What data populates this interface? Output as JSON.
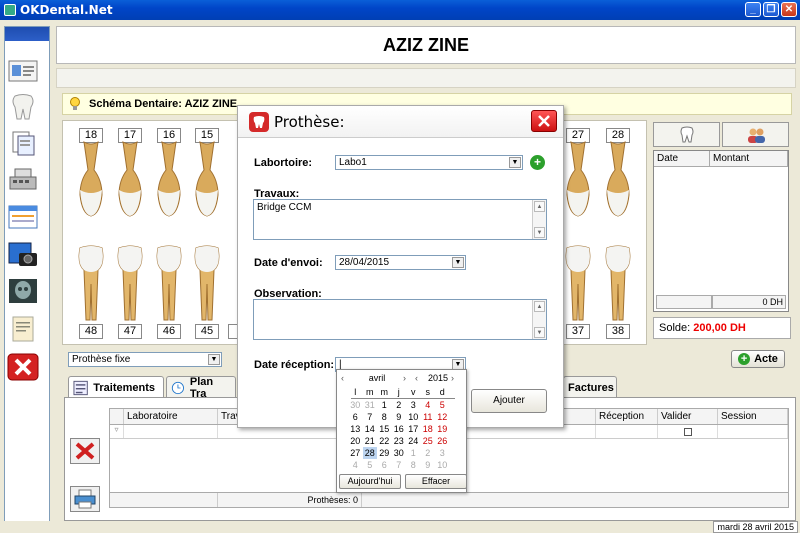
{
  "window": {
    "title": "OKDental.Net",
    "min": "_",
    "max": "❐",
    "close": "✕"
  },
  "patient": {
    "name": "AZIZ ZINE"
  },
  "schema": {
    "label": "Schéma Dentaire: AZIZ ZINE"
  },
  "teeth": {
    "upper": [
      "18",
      "17",
      "16",
      "15",
      "",
      "",
      "",
      "",
      "",
      "",
      "27",
      "28"
    ],
    "lower": [
      "48",
      "47",
      "46",
      "45",
      "4",
      "",
      "",
      "",
      "",
      "",
      "37",
      "38"
    ]
  },
  "right_panel": {
    "columns": [
      "Date",
      "Montant"
    ],
    "total": "0 DH",
    "solde_label": "Solde:",
    "solde_value": "200,00 DH"
  },
  "prothese_type": {
    "value": "Prothèse fixe"
  },
  "acte_button": "Acte",
  "tabs": [
    "Traitements",
    "Plan Tra",
    "Factures"
  ],
  "grid": {
    "columns": [
      "Laboratoire",
      "Trav",
      "",
      "Réception",
      "Valider",
      "Session"
    ],
    "footer": "Prothèses: 0"
  },
  "dialog": {
    "title": "Prothèse:",
    "labo_label": "Labortoire:",
    "labo_value": "Labo1",
    "travaux_label": "Travaux:",
    "travaux_value": "Bridge CCM",
    "date_envoi_label": "Date d'envoi:",
    "date_envoi_value": "28/04/2015",
    "observation_label": "Observation:",
    "date_reception_label": "Date réception:",
    "date_reception_value": "|",
    "add_button": "Ajouter"
  },
  "calendar": {
    "month": "avril",
    "year": "2015",
    "weekdays": [
      "l",
      "m",
      "m",
      "j",
      "v",
      "s",
      "d"
    ],
    "weeks": [
      [
        "30",
        "31",
        "1",
        "2",
        "3",
        "4",
        "5"
      ],
      [
        "6",
        "7",
        "8",
        "9",
        "10",
        "11",
        "12"
      ],
      [
        "13",
        "14",
        "15",
        "16",
        "17",
        "18",
        "19"
      ],
      [
        "20",
        "21",
        "22",
        "23",
        "24",
        "25",
        "26"
      ],
      [
        "27",
        "28",
        "29",
        "30",
        "1",
        "2",
        "3"
      ],
      [
        "4",
        "5",
        "6",
        "7",
        "8",
        "9",
        "10"
      ]
    ],
    "today_button": "Aujourd'hui",
    "clear_button": "Effacer"
  },
  "status": {
    "date": "mardi 28 avril 2015"
  },
  "colors": {
    "titlebar": "#0a5fd8",
    "solde": "#e00000",
    "weekend": "#cc0000",
    "selected_day": "#bcd4f0",
    "close_red": "#d02020"
  }
}
